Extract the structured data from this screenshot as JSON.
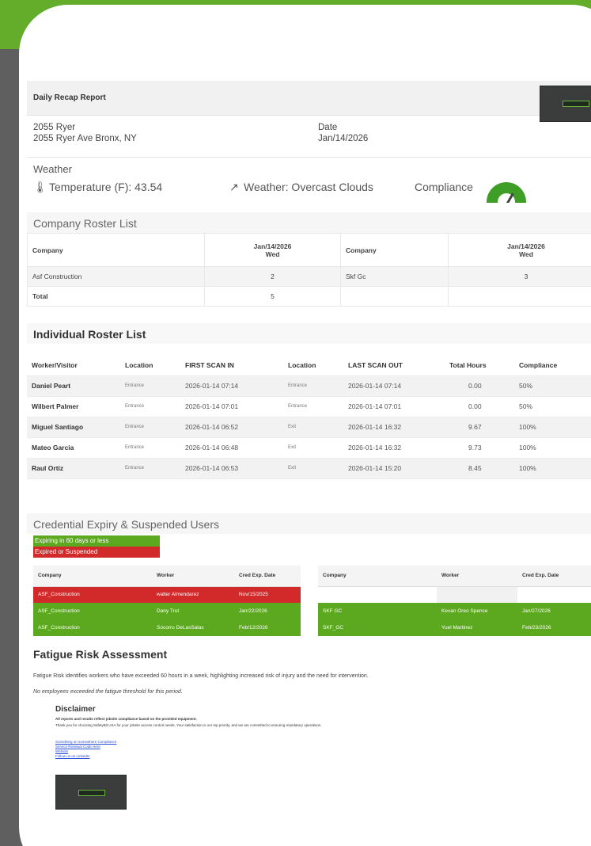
{
  "report": {
    "title": "Daily Recap Report",
    "address_line1": "2055 Ryer",
    "address_line2": "2055 Ryer Ave Bronx, NY",
    "date_label": "Date",
    "date_value": "Jan/14/2026"
  },
  "weather": {
    "title": "Weather",
    "temperature": "Temperature (F): 43.54",
    "conditions": "Weather: Overcast Clouds",
    "compliance_label": "Compliance"
  },
  "company_roster": {
    "title": "Company Roster List",
    "col_company": "Company",
    "col_date": "Jan/14/2026",
    "col_day": "Wed",
    "rows": [
      {
        "company": "Asf Construction",
        "count": "2",
        "company2": "Skf Gc",
        "count2": "3"
      },
      {
        "company": "Total",
        "count": "5",
        "company2": "",
        "count2": ""
      }
    ]
  },
  "individual_roster": {
    "title": "Individual Roster List",
    "headers": [
      "Worker/Visitor",
      "Location",
      "FIRST SCAN IN",
      "Location",
      "LAST SCAN OUT",
      "Total Hours",
      "Compliance"
    ],
    "rows": [
      {
        "name": "Daniel Peart",
        "loc_in": "Entrance",
        "first_in": "2026-01-14 07:14",
        "loc_out": "Entrance",
        "last_out": "2026-01-14 07:14",
        "hours": "0.00",
        "compliance": "50%"
      },
      {
        "name": "Wilbert Palmer",
        "loc_in": "Entrance",
        "first_in": "2026-01-14 07:01",
        "loc_out": "Entrance",
        "last_out": "2026-01-14 07:01",
        "hours": "0.00",
        "compliance": "50%"
      },
      {
        "name": "Miguel Santiago",
        "loc_in": "Entrance",
        "first_in": "2026-01-14 06:52",
        "loc_out": "Exit",
        "last_out": "2026-01-14 16:32",
        "hours": "9.67",
        "compliance": "100%"
      },
      {
        "name": "Mateo Garcia",
        "loc_in": "Entrance",
        "first_in": "2026-01-14 06:48",
        "loc_out": "Exit",
        "last_out": "2026-01-14 16:32",
        "hours": "9.73",
        "compliance": "100%"
      },
      {
        "name": "Raul Ortiz",
        "loc_in": "Entrance",
        "first_in": "2026-01-14 06:53",
        "loc_out": "Exit",
        "last_out": "2026-01-14 15:20",
        "hours": "8.45",
        "compliance": "100%"
      }
    ]
  },
  "credentials": {
    "title": "Credential Expiry & Suspended Users",
    "legend_expiring": "Expiring in 60 days or less",
    "legend_expired": "Expired or Suspended",
    "headers": [
      "Company",
      "Worker",
      "Cred Exp. Date"
    ],
    "left_rows": [
      {
        "company": "ASF_Construction",
        "worker": "walter Almendarez",
        "date": "Nov/15/2025",
        "status": "expired"
      },
      {
        "company": "ASF_Construction",
        "worker": "Dany Trut",
        "date": "Jan/22/2026",
        "status": "expiring"
      },
      {
        "company": "ASF_Construction",
        "worker": "Socorro DeLasSalas",
        "date": "Feb/12/2026",
        "status": "expiring"
      }
    ],
    "right_rows": [
      {
        "company": "",
        "worker": "",
        "date": "",
        "status": "empty"
      },
      {
        "company": "SKF GC",
        "worker": "Kevan Oreo Spence",
        "date": "Jan/27/2026",
        "status": "expiring"
      },
      {
        "company": "SKF_GC",
        "worker": "Yuel Martinez",
        "date": "Feb/23/2026",
        "status": "expiring"
      }
    ]
  },
  "fatigue": {
    "title": "Fatigue Risk Assessment",
    "description": "Fatigue Risk identifies workers who have exceeded 60 hours in a week, highlighting increased risk of injury and the need for intervention.",
    "result": "No employees exceeded the fatigue threshold for this period."
  },
  "disclaimer": {
    "title": "Disclaimer",
    "text1": "All reports and results reflect jobsite compliance based on the provided equipment.",
    "text2": "Thank you for choosing SafetyBit USA for your jobsite access control needs. Your satisfaction is our top priority, and we are committed to ensuring mandatory operations.",
    "links": [
      "Something on somewhere Compliance",
      "Service Renewal Code Here",
      "Website",
      "Follow us on LinkedIn"
    ]
  },
  "colors": {
    "brand_green": "#63ad2b",
    "expired_red": "#d22a2a",
    "expiring_green": "#5ca81f"
  }
}
